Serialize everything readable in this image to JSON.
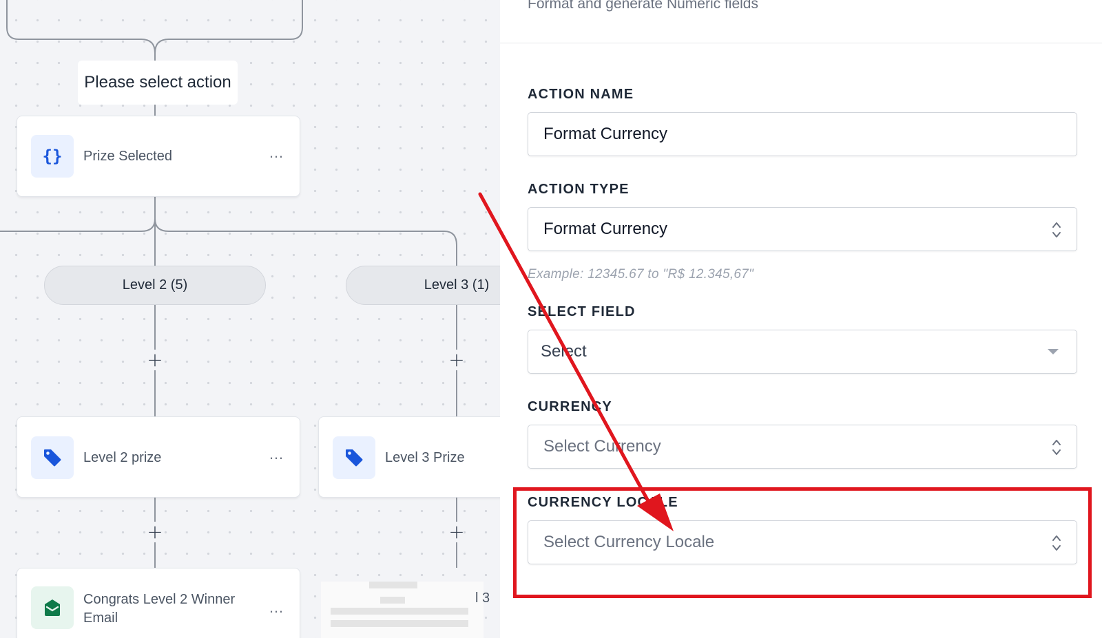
{
  "canvas": {
    "trigger_label": "Please select action",
    "nodes": {
      "prize_selected": {
        "title": "Prize Selected",
        "icon": "code-braces-icon"
      },
      "level2_prize": {
        "title": "Level 2 prize",
        "icon": "tag-icon"
      },
      "level3_prize": {
        "title": "Level 3 Prize",
        "icon": "tag-icon"
      },
      "level2_email": {
        "title_line1": "Congrats Level 2 Winner",
        "title_line2": "Email",
        "icon": "email-icon"
      },
      "level3_email_partial": "l 3"
    },
    "more_label": "…",
    "branches": {
      "level2": "Level 2 (5)",
      "level3": "Level 3 (1)"
    },
    "add_symbol": "+"
  },
  "panel": {
    "subtitle": "Format and generate Numeric fields",
    "fields": {
      "action_name": {
        "label": "ACTION NAME",
        "value": "Format Currency"
      },
      "action_type": {
        "label": "ACTION TYPE",
        "value": "Format Currency",
        "hint": "Example: 12345.67 to \"R$ 12.345,67\""
      },
      "select_field": {
        "label": "SELECT FIELD",
        "placeholder": "Select"
      },
      "currency": {
        "label": "CURRENCY",
        "placeholder": "Select Currency"
      },
      "currency_locale": {
        "label": "CURRENCY LOCALE",
        "placeholder": "Select Currency Locale"
      }
    }
  },
  "annotation": {
    "color": "#e0161e"
  },
  "colors": {
    "accent_blue": "#1a56db",
    "email_green": "#0f7a4a",
    "canvas_bg": "#f3f4f7"
  }
}
